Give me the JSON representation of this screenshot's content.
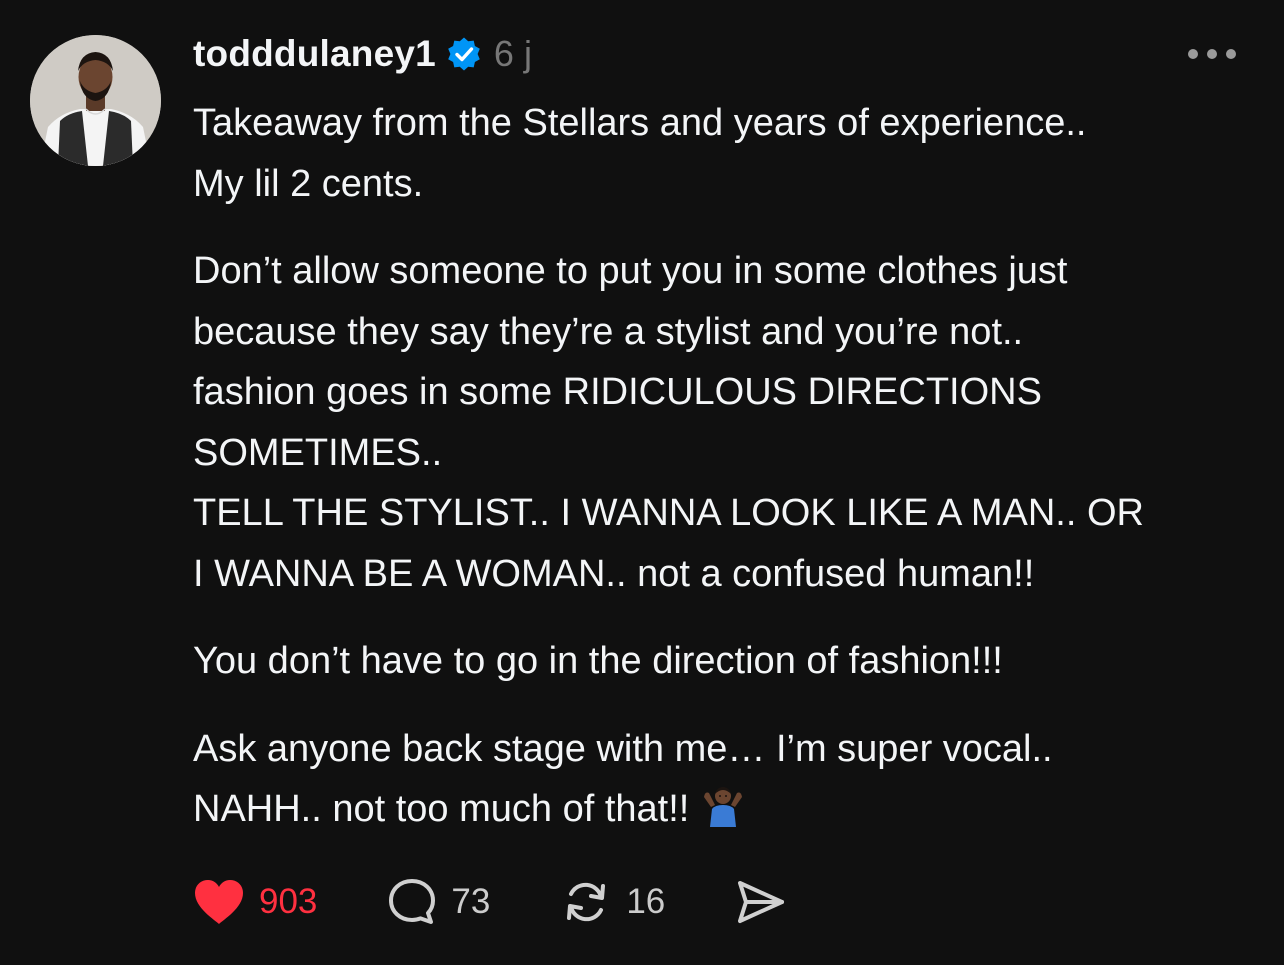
{
  "post": {
    "author": {
      "username": "todddulaney1",
      "verified": true,
      "verified_color": "#0095f6"
    },
    "time": "6 j",
    "more_icon": "ellipsis-icon",
    "paragraphs": [
      [
        "Takeaway from the Stellars and years of experience..",
        "My lil 2 cents."
      ],
      [
        "Don’t allow someone to put you in some clothes just",
        "because they say they’re a stylist and you’re not..",
        "fashion goes in some RIDICULOUS DIRECTIONS",
        "SOMETIMES..",
        "TELL THE STYLIST.. I WANNA LOOK LIKE A MAN.. OR",
        "I WANNA BE A WOMAN.. not a confused human!!"
      ],
      [
        "You don’t have to go in the direction of fashion!!!"
      ],
      [
        "Ask anyone back stage with me… I’m super vocal..",
        "NAHH.. not too much of that!!"
      ]
    ],
    "emoji": "person-shrugging-emoji",
    "actions": {
      "like": {
        "icon": "heart-icon",
        "count": "903",
        "liked": true,
        "color": "#ff3040"
      },
      "reply": {
        "icon": "comment-icon",
        "count": "73"
      },
      "repost": {
        "icon": "repost-icon",
        "count": "16"
      },
      "share": {
        "icon": "send-icon"
      }
    }
  }
}
